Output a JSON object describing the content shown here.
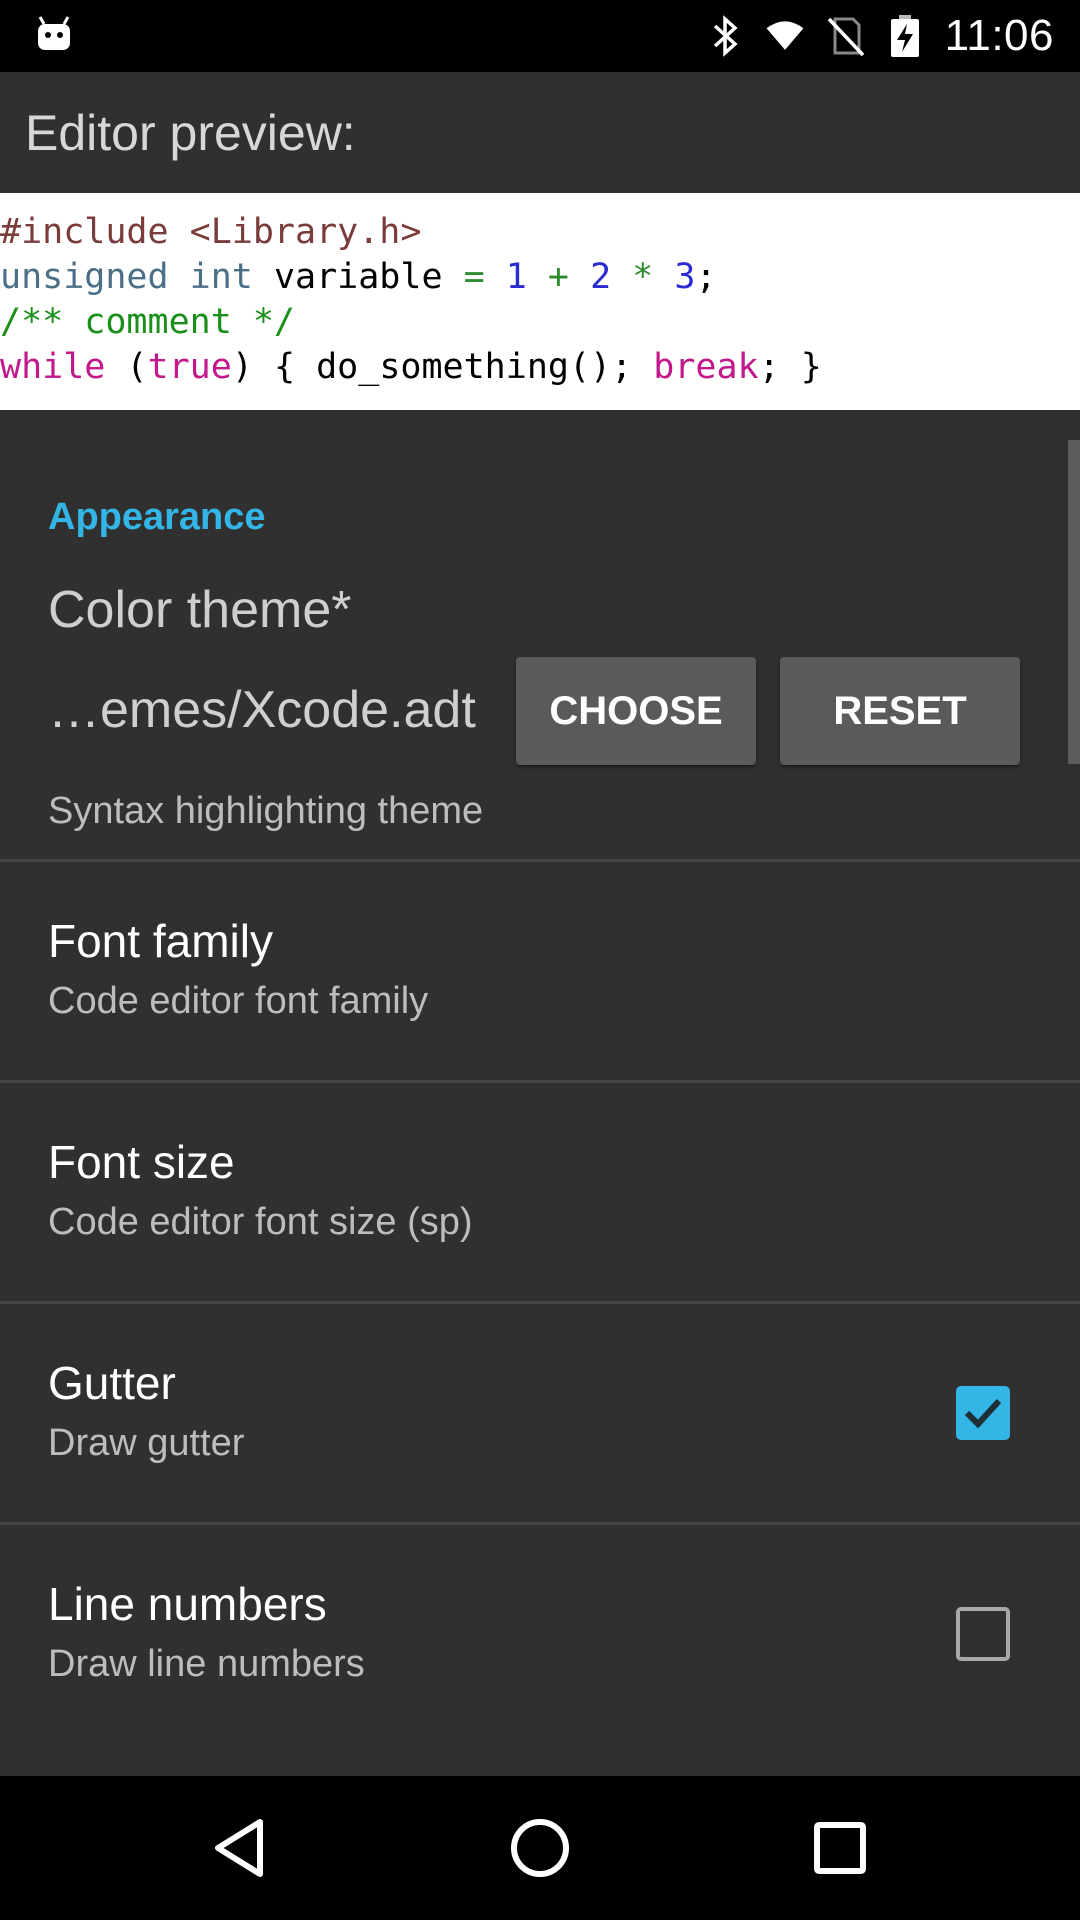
{
  "status_bar": {
    "time": "11:06",
    "icons": [
      "android-icon",
      "bluetooth-icon",
      "wifi-icon",
      "no-sim-icon",
      "battery-charging-icon"
    ]
  },
  "preview": {
    "title": "Editor preview:",
    "code_lines": [
      [
        {
          "t": "#include <Library.h>",
          "c": "pre"
        }
      ],
      [
        {
          "t": "unsigned int",
          "c": "type"
        },
        {
          "t": " variable ",
          "c": "plain"
        },
        {
          "t": "=",
          "c": "op"
        },
        {
          "t": " ",
          "c": "plain"
        },
        {
          "t": "1",
          "c": "num"
        },
        {
          "t": " ",
          "c": "plain"
        },
        {
          "t": "+",
          "c": "op"
        },
        {
          "t": " ",
          "c": "plain"
        },
        {
          "t": "2",
          "c": "num"
        },
        {
          "t": " ",
          "c": "plain"
        },
        {
          "t": "*",
          "c": "op"
        },
        {
          "t": " ",
          "c": "plain"
        },
        {
          "t": "3",
          "c": "num"
        },
        {
          "t": ";",
          "c": "plain"
        }
      ],
      [
        {
          "t": "/** comment */",
          "c": "com"
        }
      ],
      [
        {
          "t": "while",
          "c": "kw"
        },
        {
          "t": " (",
          "c": "plain"
        },
        {
          "t": "true",
          "c": "kw"
        },
        {
          "t": ") { do_something(); ",
          "c": "plain"
        },
        {
          "t": "break",
          "c": "kw"
        },
        {
          "t": "; }",
          "c": "plain"
        }
      ]
    ]
  },
  "appearance": {
    "category": "Appearance",
    "color_theme_title": "Color theme*",
    "color_theme_path": "…emes/Xcode.adt",
    "choose_label": "CHOOSE",
    "reset_label": "RESET",
    "color_theme_summary": "Syntax highlighting theme"
  },
  "prefs": {
    "font_family": {
      "title": "Font family",
      "summary": "Code editor font family"
    },
    "font_size": {
      "title": "Font size",
      "summary": "Code editor font size (sp)"
    },
    "gutter": {
      "title": "Gutter",
      "summary": "Draw gutter",
      "checked": true
    },
    "line_numbers": {
      "title": "Line numbers",
      "summary": "Draw line numbers",
      "checked": false
    }
  },
  "colors": {
    "accent": "#33b5e5",
    "background": "#303030"
  }
}
